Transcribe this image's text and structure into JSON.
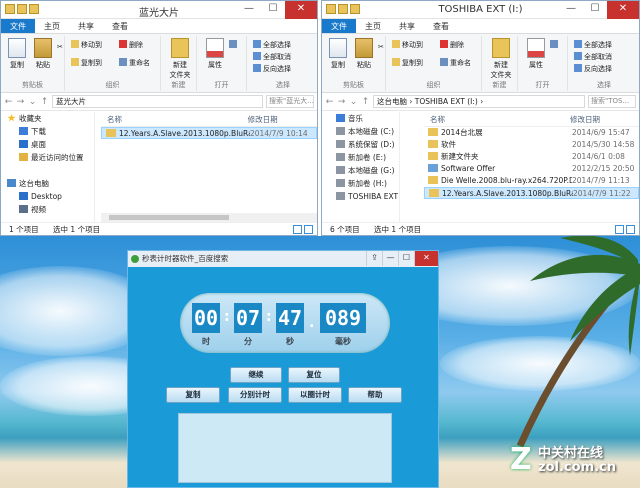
{
  "windows": [
    {
      "title": "蓝光大片",
      "tabs": [
        "文件",
        "主页",
        "共享",
        "查看"
      ],
      "ribbon": {
        "clipboard": {
          "copy": "复制",
          "paste": "粘贴",
          "label": "剪贴板"
        },
        "organize": {
          "move_to": "移动到",
          "copy_to": "复制到",
          "delete": "删除",
          "rename": "重命名",
          "label": "组织"
        },
        "new": {
          "new_folder": "新建\n文件夹",
          "label": "新建"
        },
        "open": {
          "properties": "属性",
          "label": "打开"
        },
        "select": {
          "select_all": "全部选择",
          "select_none": "全部取消",
          "invert": "反向选择",
          "label": "选择"
        }
      },
      "address": "蓝光大片",
      "search_placeholder": "搜索\"蓝光大...",
      "tree": [
        "收藏夹",
        "下载",
        "桌面",
        "最近访问的位置",
        "",
        "这台电脑",
        "Desktop",
        "视频"
      ],
      "columns": {
        "name": "名称",
        "date": "修改日期"
      },
      "rows": [
        {
          "name": "12.Years.A.Slave.2013.1080p.BluRay.A...",
          "date": "2014/7/9 10:14",
          "selected": true
        }
      ],
      "status": {
        "count": "1 个项目",
        "selected": "选中 1 个项目"
      }
    },
    {
      "title": "TOSHIBA EXT (I:)",
      "tabs": [
        "文件",
        "主页",
        "共享",
        "查看"
      ],
      "ribbon": {
        "clipboard": {
          "copy": "复制",
          "paste": "粘贴",
          "label": "剪贴板"
        },
        "organize": {
          "move_to": "移动到",
          "copy_to": "复制到",
          "delete": "删除",
          "rename": "重命名",
          "label": "组织"
        },
        "new": {
          "new_folder": "新建\n文件夹",
          "label": "新建"
        },
        "open": {
          "properties": "属性",
          "label": "打开"
        },
        "select": {
          "select_all": "全部选择",
          "select_none": "全部取消",
          "invert": "反向选择",
          "label": "选择"
        }
      },
      "address": "这台电脑 › TOSHIBA EXT (I:) ›",
      "search_placeholder": "搜索\"TOS...",
      "tree": [
        "音乐",
        "本地磁盘 (C:)",
        "系统保留 (D:)",
        "新加卷 (E:)",
        "本地磁盘 (G:)",
        "新加卷 (H:)",
        "TOSHIBA EXT (I"
      ],
      "columns": {
        "name": "名称",
        "date": "修改日期"
      },
      "rows": [
        {
          "name": "2014台北展",
          "date": "2014/6/9 15:47",
          "selected": false
        },
        {
          "name": "软件",
          "date": "2014/5/30 14:58",
          "selected": false
        },
        {
          "name": "新建文件夹",
          "date": "2014/6/1 0:08",
          "selected": false
        },
        {
          "name": "Software Offer",
          "date": "2012/2/15 20:50",
          "selected": false
        },
        {
          "name": "Die Welle.2008.blu-ray.x264.720P.DTS...",
          "date": "2014/7/9 11:13",
          "selected": false
        },
        {
          "name": "12.Years.A.Slave.2013.1080p.BluRay.A...",
          "date": "2014/7/9 11:22",
          "selected": true
        }
      ],
      "status": {
        "count": "6 个项目",
        "selected": "选中 1 个项目"
      }
    }
  ],
  "stopwatch": {
    "title": "秒表计时器软件_百度搜索",
    "digits": {
      "hours": "00",
      "minutes": "07",
      "seconds": "47",
      "ms": "089"
    },
    "units": {
      "hours": "时",
      "minutes": "分",
      "seconds": "秒",
      "ms": "毫秒"
    },
    "buttons": {
      "continue": "继续",
      "reset": "复位",
      "copy": "复制",
      "split": "分别计时",
      "lap": "以圈计时",
      "help": "帮助"
    }
  },
  "watermark": {
    "brand": "中关村在线",
    "site": "zol.com.cn",
    "letter": "Z"
  },
  "colors": {
    "file_tab": "#1979ca",
    "clock_digit_bg": "#1a88c4",
    "app_bg": "#1a9bd7"
  }
}
